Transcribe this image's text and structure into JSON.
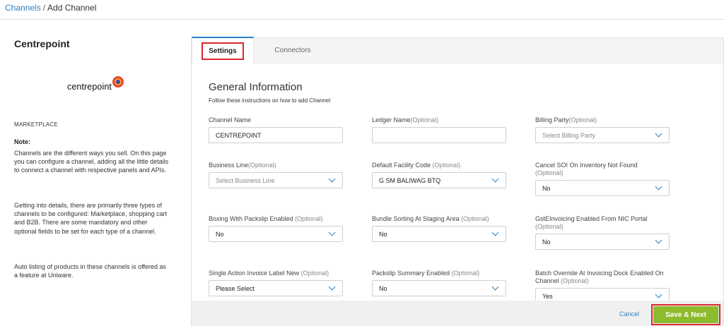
{
  "breadcrumb": {
    "parent": "Channels",
    "separator": "/",
    "current": "Add Channel"
  },
  "left": {
    "title": "Centrepoint",
    "logo_text": "centrepoint",
    "type": "MARKETPLACE",
    "note_title": "Note:",
    "note_paragraphs": [
      "Channels are the different ways you sell. On this page you can configure a channel, adding all the little details to connect a channel with respective panels and APIs.",
      "Getting into details, there are primarily three types of channels to be configured: Marketplace, shopping cart and B2B. There are some mandatory and other optional fields to be set for each type of a channel.",
      "Auto listing of products in these channels is offered as a feature at Uniware."
    ]
  },
  "tabs": [
    {
      "label": "Settings",
      "active": true
    },
    {
      "label": "Connectors",
      "active": false
    }
  ],
  "form": {
    "title": "General Information",
    "subtitle": "Follow these instructions on how to add Channel",
    "fields": [
      {
        "label": "Channel Name",
        "optional": "",
        "value": "CENTREPOINT",
        "placeholder": "",
        "type": "text"
      },
      {
        "label": "Ledger Name",
        "optional": "(Optional)",
        "value": "",
        "placeholder": "",
        "type": "text"
      },
      {
        "label": "Billing Party",
        "optional": "(Optional)",
        "value": "",
        "placeholder": "Select Billing Party",
        "type": "select"
      },
      {
        "label": "Business Line",
        "optional": "(Optional)",
        "value": "",
        "placeholder": "Select Business Line",
        "type": "select"
      },
      {
        "label": "Default Facility Code ",
        "optional": "(Optional)",
        "value": "G SM BALIWAG BTQ",
        "placeholder": "",
        "type": "select"
      },
      {
        "label": "Cancel SOI On Inventory Not Found",
        "optional": "(Optional)",
        "value": "No",
        "placeholder": "",
        "type": "select"
      },
      {
        "label": "Boxing With Packslip Enabled ",
        "optional": "(Optional)",
        "value": "No",
        "placeholder": "",
        "type": "select"
      },
      {
        "label": "Bundle Sorting At Staging Area ",
        "optional": "(Optional)",
        "value": "No",
        "placeholder": "",
        "type": "select"
      },
      {
        "label": "GstEInvoicing Enabled From NIC Portal",
        "optional": "(Optional)",
        "value": "No",
        "placeholder": "",
        "type": "select"
      },
      {
        "label": "Single Action Invoice Label New ",
        "optional": "(Optional)",
        "value": "Please Select",
        "placeholder": "",
        "type": "select"
      },
      {
        "label": "Packslip Summary Enabled ",
        "optional": "(Optional)",
        "value": "No",
        "placeholder": "",
        "type": "select"
      },
      {
        "label": "Batch Override At Invoicing Dock Enabled On Channel",
        "optional": "(Optional)",
        "value": "Yes",
        "placeholder": "",
        "type": "select"
      }
    ]
  },
  "footer": {
    "cancel_label": "Cancel",
    "save_label": "Save & Next"
  },
  "colors": {
    "accent": "#2d7fc1",
    "save": "#8dbb2e",
    "highlight": "#d9272e"
  }
}
